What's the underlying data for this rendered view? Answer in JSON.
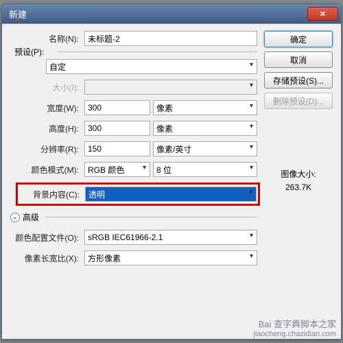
{
  "window": {
    "title": "新建"
  },
  "labels": {
    "name": "名称(N):",
    "preset": "预设(P):",
    "size": "大小(I):",
    "width": "宽度(W):",
    "height": "高度(H):",
    "resolution": "分辨率(R):",
    "colorMode": "颜色模式(M):",
    "bgContent": "背景内容(C):",
    "advanced": "高级",
    "colorProfile": "颜色配置文件(O):",
    "pixelAspect": "像素长宽比(X):",
    "imageSize": "图像大小:"
  },
  "values": {
    "name": "未标题-2",
    "preset": "自定",
    "size": "",
    "width": "300",
    "widthUnit": "像素",
    "height": "300",
    "heightUnit": "像素",
    "resolution": "150",
    "resolutionUnit": "像素/英寸",
    "colorMode": "RGB 颜色",
    "colorDepth": "8 位",
    "bgContent": "透明",
    "colorProfile": "sRGB IEC61966-2.1",
    "pixelAspect": "方形像素",
    "imageSize": "263.7K"
  },
  "buttons": {
    "ok": "确定",
    "cancel": "取消",
    "savePreset": "存储预设(S)...",
    "deletePreset": "删除预设(D)..."
  },
  "watermark": {
    "line1": "Bai",
    "line2": "查字典脚本之家",
    "line3": "jiaocheng.chazidian.com"
  }
}
